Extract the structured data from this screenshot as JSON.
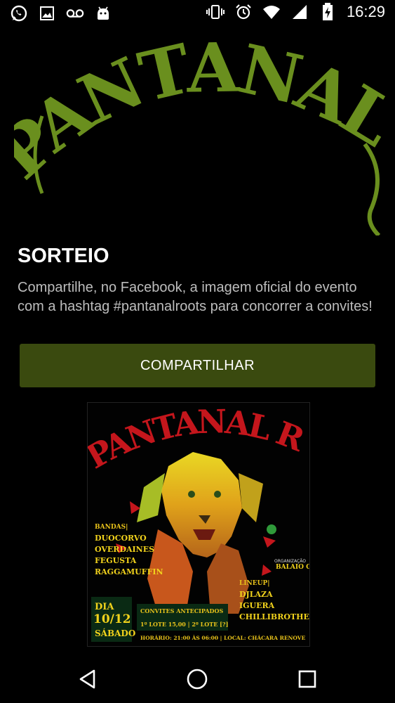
{
  "status_bar": {
    "time": "16:29",
    "left_icons": [
      "whatsapp-icon",
      "image-icon",
      "voicemail-icon",
      "android-icon"
    ],
    "right_icons": [
      "vibrate-icon",
      "alarm-icon",
      "wifi-icon",
      "signal-icon",
      "battery-charging-icon"
    ]
  },
  "logo": {
    "text": "PANTANAL ROOTS",
    "color": "#6a8f1e"
  },
  "sorteio": {
    "title": "SORTEIO",
    "description": "Compartilhe, no Facebook, a imagem oficial do evento com a hashtag #pantanalroots para concorrer a convites!"
  },
  "share_button": {
    "label": "COMPARTILHAR",
    "color": "#3a4a0f"
  },
  "poster": {
    "logo_text": "PANTANAL ROOTS",
    "bands_label": "BANDAS|",
    "bands": [
      "DUOCORVO",
      "OVERDAINES",
      "FEGUSTA",
      "RAGGAMUFFIN"
    ],
    "organizer_label": "ORGANIZAÇÃO",
    "organizer_name": "BALAIO COLETIVO",
    "lineup_label": "LINEUP|",
    "lineup": [
      "DJLAZA",
      "IGUERA",
      "CHILLIBROTHERS"
    ],
    "day_label": "DIA",
    "date": "10/12",
    "weekday": "SÁBADO",
    "tickets_label": "CONVITES ANTECIPADOS",
    "tickets_lots": "1º LOTE 15,00 | 2º LOTE [?]",
    "schedule": "HORÁRIO: 21:00 ÀS 06:00 | LOCAL: CHÁCARA RENOVE"
  },
  "nav_bar": {
    "icons": [
      "back-icon",
      "home-icon",
      "recents-icon"
    ]
  }
}
